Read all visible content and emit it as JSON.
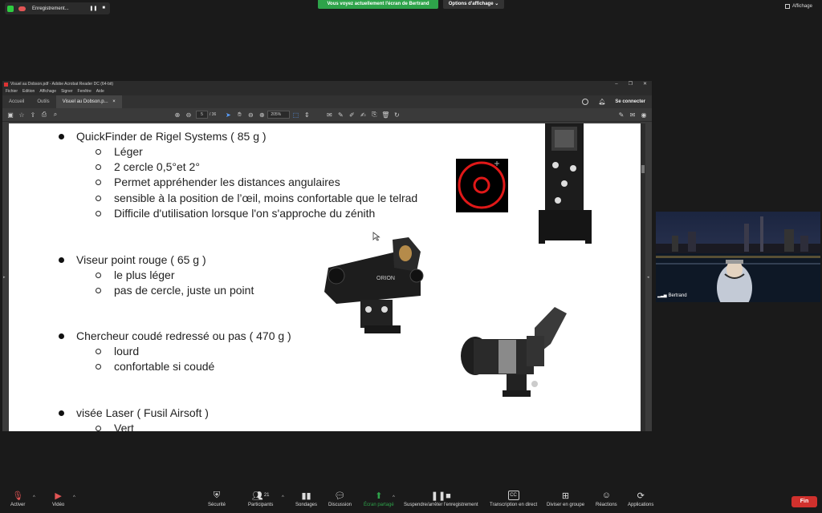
{
  "zoom": {
    "recording_label": "Enregistrement...",
    "share_banner": "Vous voyez actuellement l'écran de Bertrand",
    "view_options": "Options d'affichage",
    "view_options_caret": "⌄",
    "affichage": "Affichage",
    "participant_name": "Bertrand",
    "bottom": {
      "mute": "Activer",
      "video": "Vidéo",
      "security": "Sécurité",
      "participants": "Participants",
      "participants_count": "21",
      "polls": "Sondages",
      "chat": "Discussion",
      "share": "Écran partagé",
      "record": "Suspendre/arrêter l'enregistrement",
      "captions": "Transcription en direct",
      "breakout": "Diviser en groupe",
      "reactions": "Réactions",
      "apps": "Applications",
      "end": "Fin",
      "cc": "CC"
    }
  },
  "acrobat": {
    "title": "Visuel au Dobson.pdf - Adobe Acrobat Reader DC (64-bit)",
    "menu": [
      "Fichier",
      "Edition",
      "Affichage",
      "Signer",
      "Fenêtre",
      "Aide"
    ],
    "tabs": [
      "Accueil",
      "Outils",
      "Visuel au Dobson.p..."
    ],
    "tab_close": "×",
    "connect": "Se connecter",
    "page_current": "5",
    "page_total": "/ 36",
    "zoom": "205%"
  },
  "slide": {
    "items": [
      {
        "label": "QuickFinder de Rigel Systems ( 85 g )",
        "subs": [
          "Léger",
          "2 cercle 0,5°et 2°",
          "Permet appréhender les distances angulaires",
          "sensible à la position de l’œil, moins confortable que le telrad",
          "Difficile d'utilisation lorsque l'on s'approche du zénith"
        ]
      },
      {
        "label": "Viseur point rouge ( 65 g )",
        "subs": [
          "le plus léger",
          "pas de cercle, juste un point"
        ]
      },
      {
        "label": "Chercheur coudé redressé ou pas ( 470 g )",
        "subs": [
          "lourd",
          "confortable si coudé"
        ]
      },
      {
        "label": "visée Laser ( Fusil Airsoft )",
        "subs": [
          "Vert"
        ]
      }
    ],
    "orion_label": "ORION"
  },
  "colors": {
    "green": "#2ea34a",
    "end": "#d0312d",
    "reticle": "#e01818"
  }
}
